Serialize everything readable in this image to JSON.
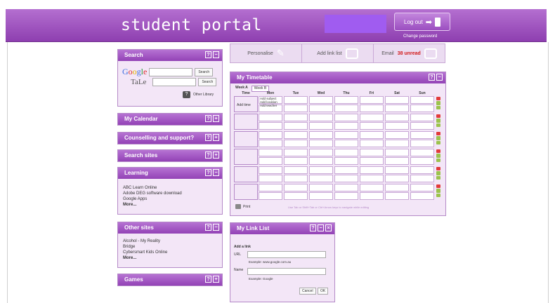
{
  "header": {
    "logo": "student portal",
    "logout_label": "Log out",
    "change_password": "Change password"
  },
  "search": {
    "title": "Search",
    "google_label": "Google",
    "tala_label": "TaLe",
    "search_button": "Search",
    "other_library": "Other Library"
  },
  "widgets": {
    "calendar": "My Calendar",
    "counselling": "Counselling and support?",
    "search_sites": "Search sites",
    "learning": "Learning",
    "other_sites": "Other sites",
    "games": "Games"
  },
  "learning_links": [
    "ABC Learn Online",
    "Adobe DEG software download",
    "Google Apps"
  ],
  "other_links": [
    "Alcohol - My Reality",
    "Bridge",
    "Cybersmart Kids Online"
  ],
  "more_label": "More...",
  "topbar": {
    "personalise": "Personalise",
    "add_link_list": "Add link list",
    "email": "Email",
    "email_count": "38 unread"
  },
  "timetable": {
    "title": "My Timetable",
    "week_a": "Week A",
    "week_b": "Week B",
    "days": [
      "Time",
      "Mon",
      "Tue",
      "Wed",
      "Thu",
      "Fri",
      "Sat",
      "Sun"
    ],
    "add_time": "Add time",
    "add_subject": "Add subject",
    "add_location": "Add location",
    "add_teacher": "Add teacher",
    "print": "Print",
    "hint": "Use Tab or Shift+Tab or Ctrl+Arrow keys to navigate while editing"
  },
  "linklist": {
    "title": "My Link List",
    "add_link": "Add a link",
    "url_label": "URL",
    "url_example": "Example: www.google.com.au",
    "name_label": "Name",
    "name_example": "Example: Google",
    "cancel": "Cancel",
    "ok": "OK"
  },
  "colors": {
    "brand": "#9a4dbd",
    "username_box": "#a05cf0",
    "widget_bg": "#f3e6f7"
  }
}
